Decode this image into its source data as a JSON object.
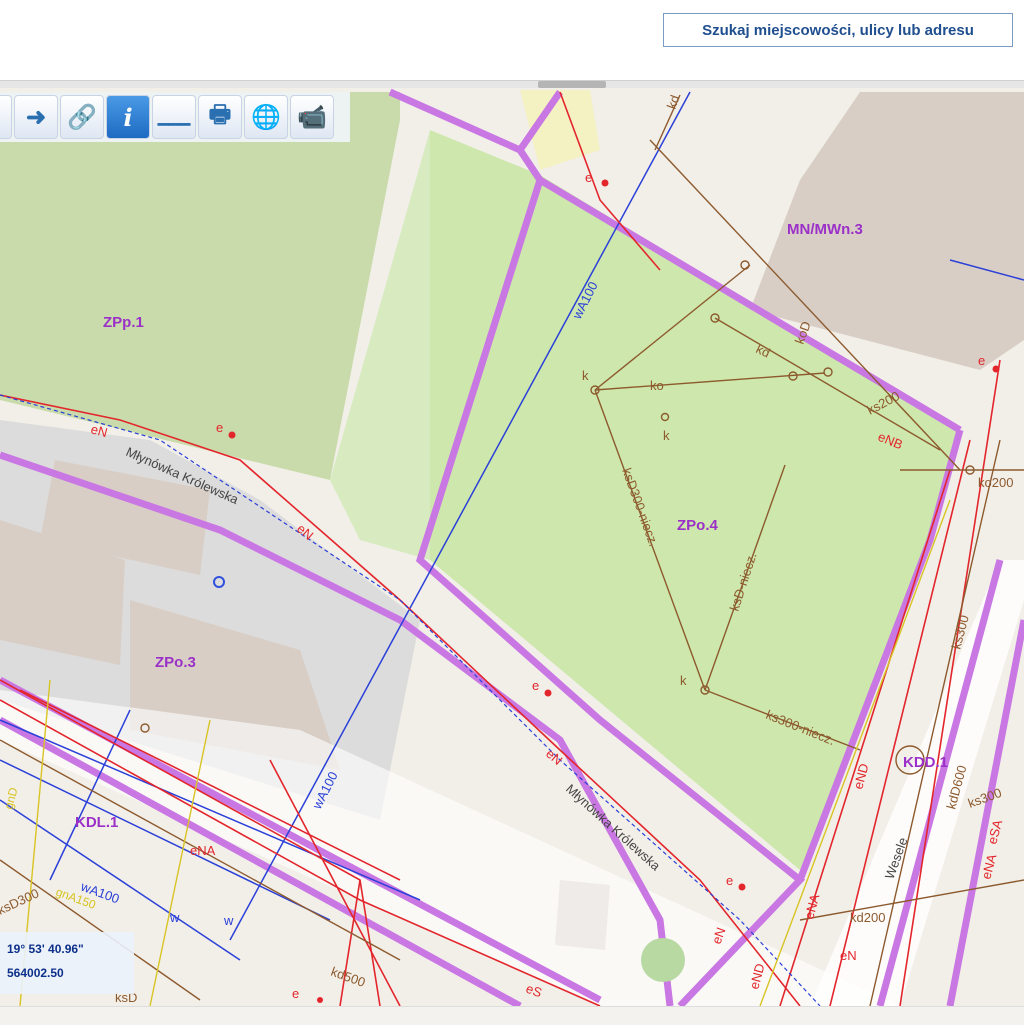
{
  "search": {
    "label": "Szukaj miejscowości, ulicy lub adresu"
  },
  "toolbar": {
    "tools": [
      {
        "name": "arrow-right-icon"
      },
      {
        "name": "link-icon"
      },
      {
        "name": "info-icon",
        "active": true
      },
      {
        "name": "measure-icon"
      },
      {
        "name": "print-icon"
      },
      {
        "name": "globe-icon"
      },
      {
        "name": "camera-icon"
      }
    ]
  },
  "map": {
    "zones": {
      "zpp1": "ZPp.1",
      "zpo3": "ZPo.3",
      "zpo4": "ZPo.4",
      "mn": "MN/MWn.3",
      "kdl1": "KDL.1",
      "kdd1": "KDD.1"
    },
    "streets": {
      "mk1": "Młynówka Królewska",
      "mk2": "Młynówka Królewska",
      "wesele": "Wesele"
    },
    "utility_labels": {
      "wa100_a": "wA100",
      "wa100_b": "wA100",
      "wa100_c": "wA100",
      "ksd300_niecz": "ksD300-niecz.",
      "ksd_niecz": "ksD-niecz.",
      "ks300_niecz": "ks300-niecz.",
      "ks200": "ks200",
      "ko200": "ko200",
      "ks300": "ks300",
      "kd600": "kdD600",
      "kd300": "ks300",
      "kd200": "kd200",
      "ksd300": "ksD300",
      "kd500": "kd500",
      "ksd": "ksD",
      "ga150": "gnA150",
      "gnd": "gnD",
      "ena": "eNA",
      "ena2": "eNA",
      "end": "eND",
      "end2": "eND",
      "end3": "eND",
      "ena3": "eNA",
      "ensa": "eSA",
      "enb": "eNB",
      "en1": "eN",
      "en2": "eN",
      "en3": "eN",
      "en4": "eN",
      "en5": "eN",
      "es": "eS",
      "ko": "ko",
      "kod": "koD",
      "kd": "kd",
      "kd2": "kd",
      "k1": "k",
      "k2": "k",
      "k3": "k",
      "e1": "e",
      "e2": "e",
      "e3": "e",
      "e4": "e",
      "e5": "e",
      "e6": "e",
      "w1": "w",
      "w2": "w"
    }
  },
  "coords": {
    "lon": "19° 53' 40.96\"",
    "y": "564002.50"
  },
  "colors": {
    "plan_border": "#c77fe0",
    "green_zone": "#cfe7b0",
    "forest": "#c7d9a8",
    "building": "#d9d0c9",
    "water_line": "#2b3fd6",
    "electric": "#e8222a",
    "sewer": "#8b5a2b",
    "gas": "#d9c21e"
  }
}
